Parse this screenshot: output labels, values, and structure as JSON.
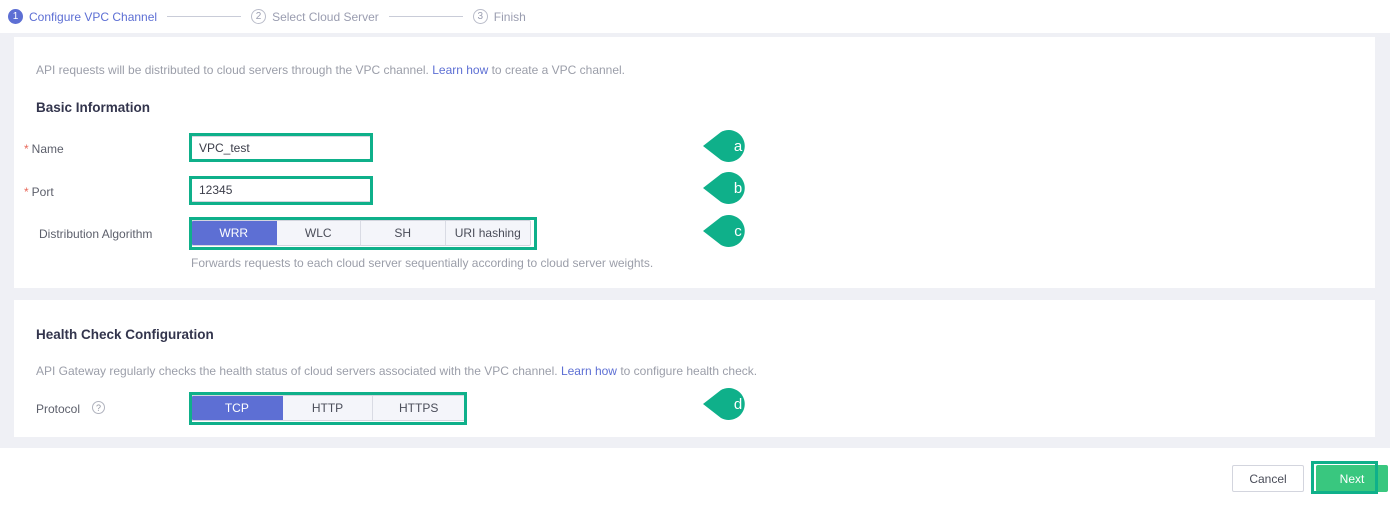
{
  "steps": [
    {
      "num": "1",
      "label": "Configure VPC Channel",
      "state": "active"
    },
    {
      "num": "2",
      "label": "Select Cloud Server",
      "state": "idle"
    },
    {
      "num": "3",
      "label": "Finish",
      "state": "idle"
    }
  ],
  "basic": {
    "description_before": "API requests will be distributed to cloud servers through the VPC channel. ",
    "description_link": "Learn how",
    "description_after": " to create a VPC channel.",
    "section_title": "Basic Information",
    "name": {
      "label": "Name",
      "required_marker": "*",
      "value": "VPC_test"
    },
    "port": {
      "label": "Port",
      "required_marker": "*",
      "value": "12345"
    },
    "algorithm": {
      "label": "Distribution Algorithm",
      "options": [
        "WRR",
        "WLC",
        "SH",
        "URI hashing"
      ],
      "selected": "WRR",
      "hint": "Forwards requests to each cloud server sequentially according to cloud server weights."
    }
  },
  "health": {
    "section_title": "Health Check Configuration",
    "description_before": "API Gateway regularly checks the health status of cloud servers associated with the VPC channel. ",
    "description_link": "Learn how",
    "description_after": " to configure health check.",
    "protocol": {
      "label": "Protocol",
      "help_icon": "question-mark-icon",
      "options": [
        "TCP",
        "HTTP",
        "HTTPS"
      ],
      "selected": "TCP"
    }
  },
  "footer": {
    "cancel_label": "Cancel",
    "next_label": "Next"
  },
  "annotations": {
    "markers": [
      {
        "letter": "a"
      },
      {
        "letter": "b"
      },
      {
        "letter": "c"
      },
      {
        "letter": "d"
      }
    ],
    "color": "#0fb08a"
  },
  "colors": {
    "accent_purple": "#5d6fd4",
    "annotation_teal": "#0fb08a",
    "next_green": "#39c77f",
    "required_red": "#e8685a",
    "page_bg": "#eff0f5"
  }
}
